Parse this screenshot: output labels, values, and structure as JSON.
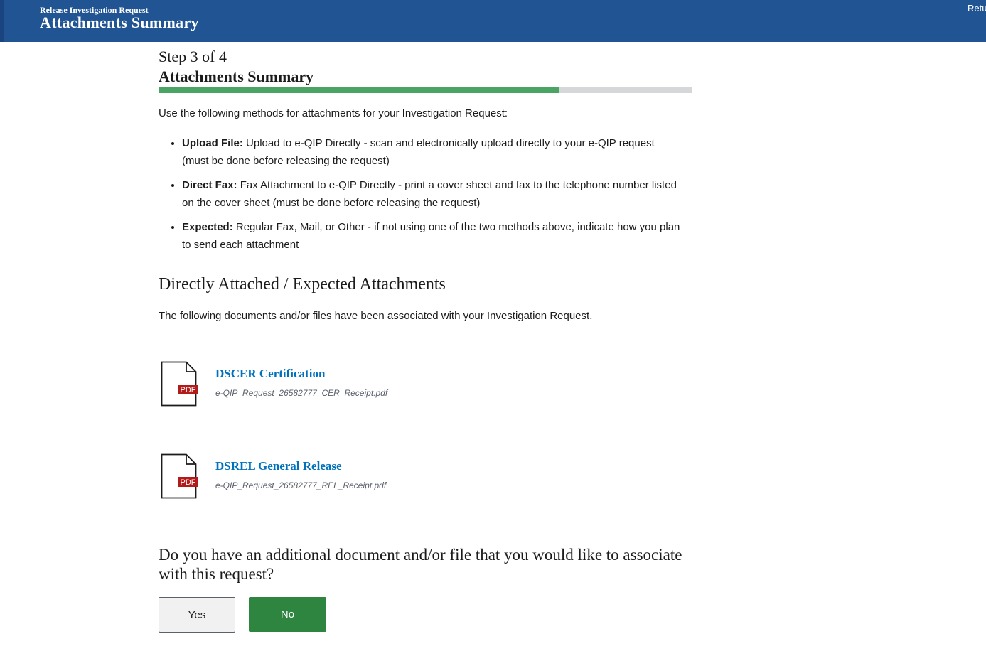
{
  "header": {
    "eyebrow": "Release Investigation Request",
    "title": "Attachments Summary",
    "return_link": "Retu"
  },
  "step": {
    "label": "Step 3 of 4",
    "title": "Attachments Summary",
    "progress_fraction": 0.75
  },
  "intro_text": "Use the following methods for attachments for your Investigation Request:",
  "methods": [
    {
      "term": "Upload File:",
      "description": "Upload to e-QIP Directly - scan and electronically upload directly to your e-QIP request (must be done before releasing the request)"
    },
    {
      "term": "Direct Fax:",
      "description": "Fax Attachment to e-QIP Directly - print a cover sheet and fax to the telephone number listed on the cover sheet (must be done before releasing the request)"
    },
    {
      "term": "Expected:",
      "description": "Regular Fax, Mail, or Other - if not using one of the two methods above, indicate how you plan to send each attachment"
    }
  ],
  "attachments_section": {
    "heading": "Directly Attached / Expected Attachments",
    "description": "The following documents and/or files have been associated with your Investigation Request."
  },
  "attachments": [
    {
      "title": "DSCER Certification",
      "filename": "e-QIP_Request_26582777_CER_Receipt.pdf",
      "badge": "PDF",
      "icon": "pdf-document-icon"
    },
    {
      "title": "DSREL General Release",
      "filename": "e-QIP_Request_26582777_REL_Receipt.pdf",
      "badge": "PDF",
      "icon": "pdf-document-icon"
    }
  ],
  "question": "Do you have an additional document and/or file that you would like to associate with this request?",
  "buttons": {
    "yes": "Yes",
    "no": "No"
  },
  "colors": {
    "header_bg": "#205493",
    "progress_fill": "#4aa564",
    "progress_track": "#d6d7d9",
    "link": "#0071bc",
    "primary_button": "#2e8540",
    "pdf_badge": "#b31b1b"
  }
}
